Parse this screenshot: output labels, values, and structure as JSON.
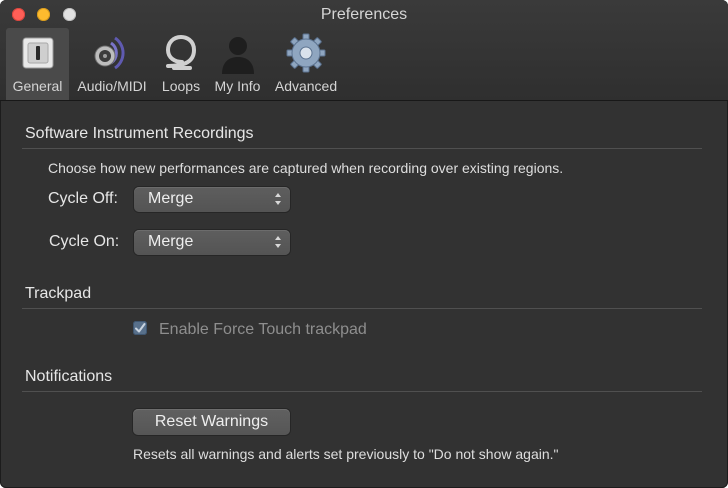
{
  "window": {
    "title": "Preferences"
  },
  "toolbar": {
    "tabs": [
      {
        "label": "General",
        "icon": "general-switch-icon",
        "selected": true
      },
      {
        "label": "Audio/MIDI",
        "icon": "speaker-icon",
        "selected": false
      },
      {
        "label": "Loops",
        "icon": "loop-icon",
        "selected": false
      },
      {
        "label": "My Info",
        "icon": "person-icon",
        "selected": false
      },
      {
        "label": "Advanced",
        "icon": "gear-icon",
        "selected": false
      }
    ]
  },
  "sections": {
    "recordings": {
      "title": "Software Instrument Recordings",
      "description": "Choose how new performances are captured when recording over existing regions.",
      "cycle_off": {
        "label": "Cycle Off:",
        "value": "Merge"
      },
      "cycle_on": {
        "label": "Cycle On:",
        "value": "Merge"
      }
    },
    "trackpad": {
      "title": "Trackpad",
      "force_touch": {
        "label": "Enable Force Touch trackpad",
        "checked": true,
        "enabled": false
      }
    },
    "notifications": {
      "title": "Notifications",
      "reset_button": "Reset Warnings",
      "reset_description": "Resets all warnings and alerts set previously to \"Do not show again.\""
    }
  },
  "colors": {
    "background": "#323232",
    "close": "#fe5f57",
    "minimize": "#febb2e",
    "checkbox": "#58708b"
  }
}
